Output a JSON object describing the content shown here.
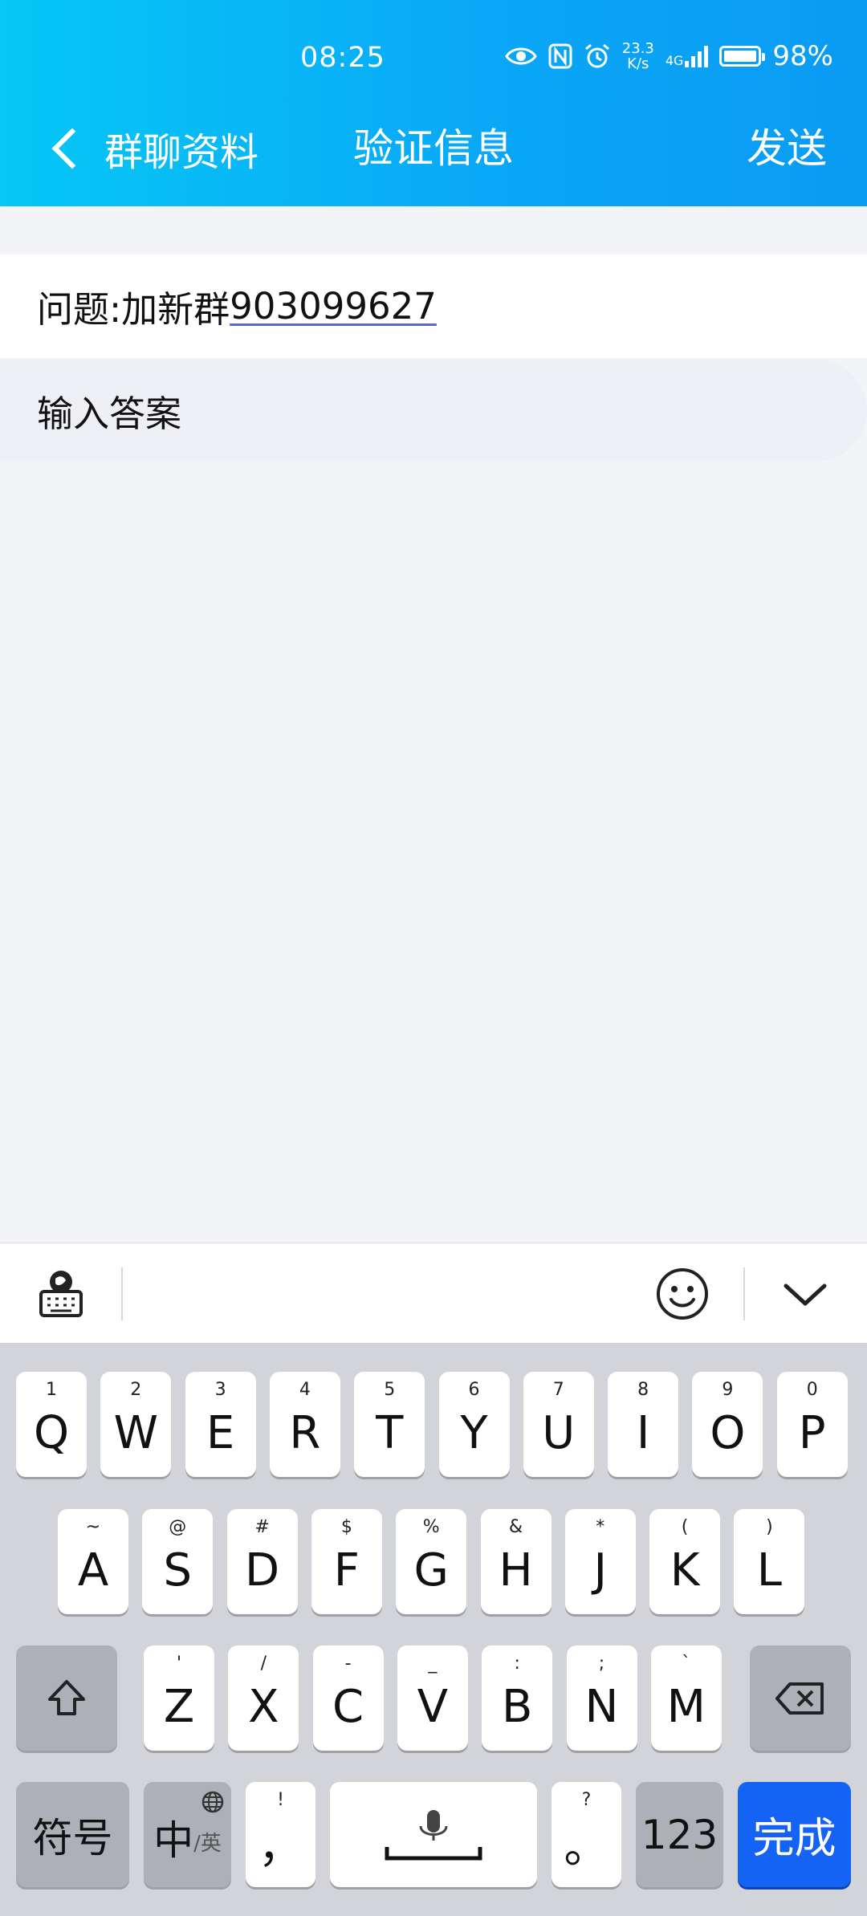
{
  "status_bar": {
    "time": "08:25",
    "speed_value": "23.3",
    "speed_unit": "K/s",
    "network": "4G",
    "battery": "98%"
  },
  "nav": {
    "back_label": "群聊资料",
    "title": "验证信息",
    "send_label": "发送"
  },
  "question": {
    "prefix": "问题:加新群",
    "number": "903099627"
  },
  "answer": {
    "placeholder": "输入答案"
  },
  "keyboard": {
    "row1": [
      {
        "hint": "1",
        "key": "Q"
      },
      {
        "hint": "2",
        "key": "W"
      },
      {
        "hint": "3",
        "key": "E"
      },
      {
        "hint": "4",
        "key": "R"
      },
      {
        "hint": "5",
        "key": "T"
      },
      {
        "hint": "6",
        "key": "Y"
      },
      {
        "hint": "7",
        "key": "U"
      },
      {
        "hint": "8",
        "key": "I"
      },
      {
        "hint": "9",
        "key": "O"
      },
      {
        "hint": "0",
        "key": "P"
      }
    ],
    "row2": [
      {
        "hint": "~",
        "key": "A"
      },
      {
        "hint": "@",
        "key": "S"
      },
      {
        "hint": "#",
        "key": "D"
      },
      {
        "hint": "$",
        "key": "F"
      },
      {
        "hint": "%",
        "key": "G"
      },
      {
        "hint": "&",
        "key": "H"
      },
      {
        "hint": "*",
        "key": "J"
      },
      {
        "hint": "(",
        "key": "K"
      },
      {
        "hint": ")",
        "key": "L"
      }
    ],
    "row3": [
      {
        "hint": "'",
        "key": "Z"
      },
      {
        "hint": "/",
        "key": "X"
      },
      {
        "hint": "-",
        "key": "C"
      },
      {
        "hint": "_",
        "key": "V"
      },
      {
        "hint": ":",
        "key": "B"
      },
      {
        "hint": ";",
        "key": "N"
      },
      {
        "hint": "`",
        "key": "M"
      }
    ],
    "symbols_label": "符号",
    "lang_label_main": "中",
    "lang_label_sub": "/英",
    "comma_hint": "!",
    "comma_key": "，",
    "period_hint": "?",
    "period_key": "。",
    "num_label": "123",
    "done_label": "完成"
  }
}
